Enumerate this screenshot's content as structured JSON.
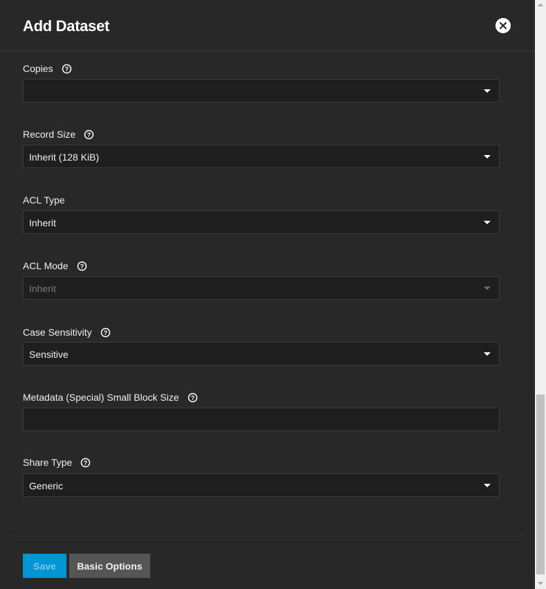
{
  "dialog": {
    "title": "Add Dataset",
    "close_icon": "close-icon"
  },
  "fields": {
    "copies": {
      "label": "Copies",
      "value": "",
      "has_help": true
    },
    "record_size": {
      "label": "Record Size",
      "value": "Inherit (128 KiB)",
      "has_help": true
    },
    "acl_type": {
      "label": "ACL Type",
      "value": "Inherit",
      "has_help": false
    },
    "acl_mode": {
      "label": "ACL Mode",
      "value": "Inherit",
      "has_help": true,
      "disabled": true
    },
    "case_sensitivity": {
      "label": "Case Sensitivity",
      "value": "Sensitive",
      "has_help": true
    },
    "special_small_block_size": {
      "label": "Metadata (Special) Small Block Size",
      "value": "",
      "has_help": true
    },
    "share_type": {
      "label": "Share Type",
      "value": "Generic",
      "has_help": true
    }
  },
  "footer": {
    "save_label": "Save",
    "basic_options_label": "Basic Options"
  },
  "colors": {
    "background": "#282828",
    "input_background": "#1e1e1e",
    "primary": "#0095d5",
    "secondary_button": "#555555"
  },
  "icons": {
    "help": "help-circle-icon",
    "dropdown": "chevron-down-icon"
  }
}
